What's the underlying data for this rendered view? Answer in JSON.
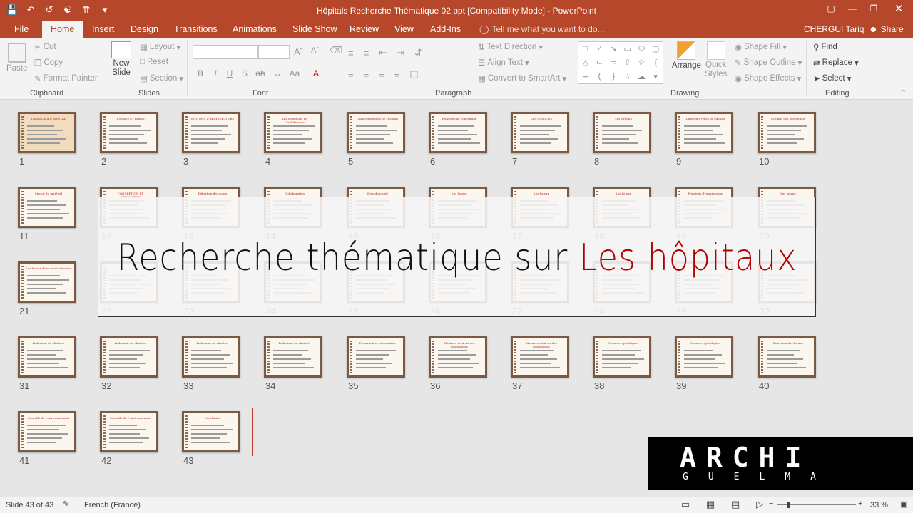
{
  "window": {
    "title": "Hôpitals Recherche Thématique 02.ppt [Compatibility Mode] - PowerPoint",
    "controls": [
      "▢",
      "—",
      "❐",
      "✕"
    ]
  },
  "qat": [
    "save-icon",
    "undo-icon",
    "redo-icon",
    "present-icon",
    "customize-icon",
    "more-icon"
  ],
  "tabs": [
    "File",
    "Home",
    "Insert",
    "Design",
    "Transitions",
    "Animations",
    "Slide Show",
    "Review",
    "View",
    "Add-Ins"
  ],
  "active_tab": "Home",
  "tell_me": "Tell me what you want to do...",
  "user": "CHERGUI Tariq",
  "share": "Share",
  "ribbon": {
    "clipboard": {
      "paste": "Paste",
      "cut": "Cut",
      "copy": "Copy",
      "format_painter": "Format Painter",
      "label": "Clipboard"
    },
    "slides": {
      "new_slide_1": "New",
      "new_slide_2": "Slide",
      "layout": "Layout",
      "reset": "Reset",
      "section": "Section",
      "label": "Slides"
    },
    "font": {
      "label": "Font"
    },
    "paragraph": {
      "text_direction": "Text Direction",
      "align_text": "Align Text",
      "convert_smartart": "Convert to SmartArt",
      "label": "Paragraph"
    },
    "drawing": {
      "arrange": "Arrange",
      "quick_1": "Quick",
      "quick_2": "Styles",
      "shape_fill": "Shape Fill",
      "shape_outline": "Shape Outline",
      "shape_effects": "Shape Effects",
      "label": "Drawing"
    },
    "editing": {
      "find": "Find",
      "replace": "Replace",
      "select": "Select",
      "label": "Editing"
    }
  },
  "slides": {
    "numbers": [
      "1",
      "2",
      "3",
      "4",
      "5",
      "6",
      "7",
      "8",
      "9",
      "10",
      "11",
      "12",
      "13",
      "14",
      "15",
      "16",
      "17",
      "18",
      "19",
      "20",
      "21",
      "22",
      "23",
      "24",
      "25",
      "26",
      "27",
      "28",
      "29",
      "30",
      "31",
      "32",
      "33",
      "34",
      "35",
      "36",
      "37",
      "38",
      "39",
      "40",
      "41",
      "42",
      "43"
    ],
    "titles": [
      "L'ESPACE À L'HÔPITAL",
      "L'espace à l'hôpital",
      "NOTIONS D'ARCHITECTURE",
      "Les évolutions de l'architecture",
      "Caractéristiques de l'hôpital",
      "Principes de conception",
      "LES CIRCUITS",
      "Les circuits",
      "Différents types de circuits",
      "Circuits des personnels",
      "Circuit du matériel",
      "CONCEPTION ET RÉNOVATION",
      "Définition des zones",
      "Collaboration",
      "Zone d'accueil",
      "Les locaux",
      "Les locaux",
      "Les locaux",
      "Principes d'organisation",
      "Les locaux",
      "Les locaux d'une unité de soins",
      "",
      "",
      "",
      "",
      "",
      "",
      "",
      "",
      "",
      "Isolement du chantier",
      "Isolement du chantier",
      "Isolement du chantier",
      "Isolement du chantier",
      "Formation et information",
      "Mesures vis-à-vis des hospitalisés",
      "Mesures vis-à-vis des hospitalisés",
      "Mesures spécifiques",
      "Mesures spécifiques",
      "Entretien des locaux",
      "Contrôle de l'environnement",
      "Contrôle de l'environnement",
      "Conclusion"
    ]
  },
  "banner": {
    "main": "Recherche thématique sur ",
    "accent": "Les hôpitaux"
  },
  "logo": {
    "big": "ARCHI",
    "small": "GUELMA"
  },
  "status": {
    "slide": "Slide 43 of 43",
    "language": "French (France)",
    "zoom": "33 %"
  },
  "zoom_level_percent": 33,
  "colors": {
    "accent": "#b7472a",
    "banner_accent": "#b00000"
  }
}
